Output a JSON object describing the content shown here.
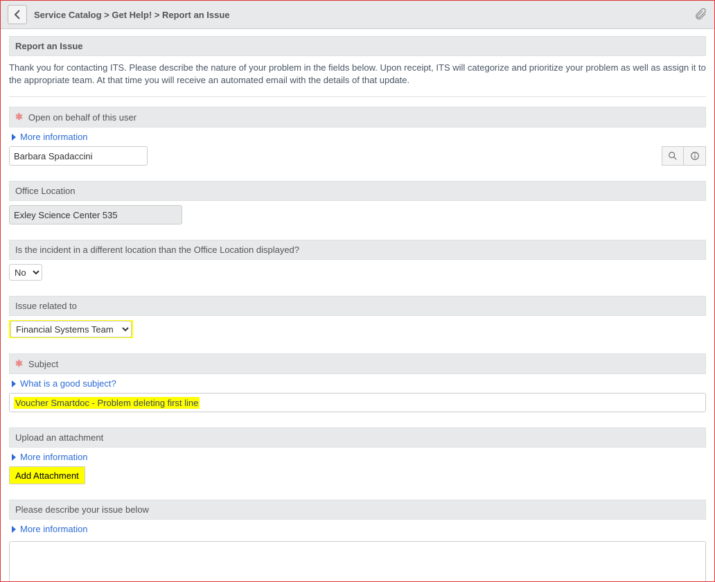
{
  "header": {
    "breadcrumb": "Service Catalog > Get Help! > Report an Issue"
  },
  "page": {
    "title": "Report an Issue",
    "intro": "Thank you for contacting ITS. Please describe the nature of your problem in the fields below. Upon receipt, ITS will categorize and prioritize your problem as well as assign it to the appropriate team.  At that time you will receive an automated email with the details of that update."
  },
  "fields": {
    "open_on_behalf": {
      "label": "Open on behalf of this user",
      "more_info": "More information",
      "value": "Barbara Spadaccini"
    },
    "office_location": {
      "label": "Office Location",
      "value": "Exley Science Center 535"
    },
    "diff_location": {
      "label": "Is the incident in a different location than the Office Location displayed?",
      "value": "No"
    },
    "issue_related": {
      "label": "Issue related to",
      "value": "Financial Systems Team"
    },
    "subject": {
      "label": "Subject",
      "help": "What is a good subject?",
      "value": "Voucher Smartdoc - Problem deleting first line"
    },
    "attachment": {
      "label": "Upload an attachment",
      "more_info": "More information",
      "button": "Add Attachment"
    },
    "description": {
      "label": "Please describe your issue below",
      "more_info": "More information",
      "value": ""
    }
  }
}
